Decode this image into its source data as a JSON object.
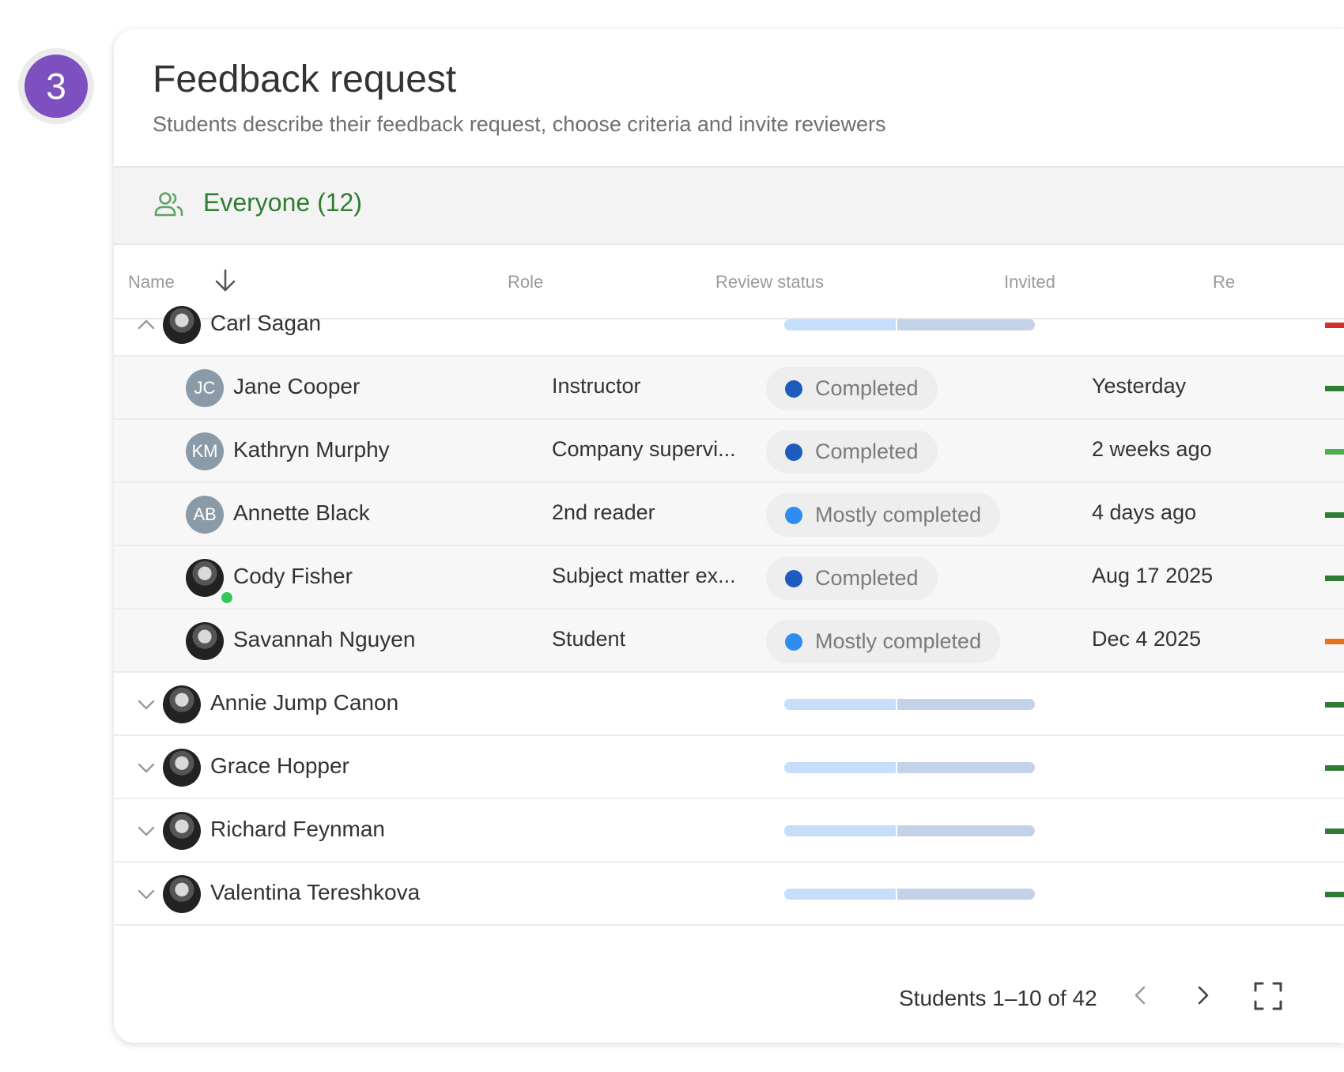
{
  "step": {
    "number": "3"
  },
  "header": {
    "title": "Feedback request",
    "subtitle": "Students describe their feedback request, choose criteria and invite reviewers"
  },
  "group": {
    "icon": "people-icon",
    "label": "Everyone (12)",
    "color": "#2e7d32"
  },
  "columns": {
    "name": "Name",
    "role": "Role",
    "review_status": "Review status",
    "invited": "Invited",
    "partial": "Re"
  },
  "rows": [
    {
      "type": "student",
      "expanded": true,
      "name": "Carl Sagan",
      "progress": 0.45,
      "marker": "#d32f2f"
    },
    {
      "type": "reviewer",
      "name": "Jane Cooper",
      "initials": "JC",
      "role": "Instructor",
      "status": "Completed",
      "status_color": "#1e5bbf",
      "invited": "Yesterday",
      "marker": "#2e7d32"
    },
    {
      "type": "reviewer",
      "name": "Kathryn Murphy",
      "initials": "KM",
      "role": "Company supervi...",
      "status": "Completed",
      "status_color": "#1e5bbf",
      "invited": "2 weeks ago",
      "marker": "#4caf50"
    },
    {
      "type": "reviewer",
      "name": "Annette Black",
      "initials": "AB",
      "role": "2nd reader",
      "status": "Mostly completed",
      "status_color": "#2d8cf0",
      "invited": "4 days ago",
      "marker": "#2e7d32"
    },
    {
      "type": "reviewer",
      "name": "Cody Fisher",
      "initials": "",
      "online": true,
      "role": "Subject matter ex...",
      "status": "Completed",
      "status_color": "#1e5bbf",
      "invited": "Aug 17 2025",
      "marker": "#2e7d32"
    },
    {
      "type": "reviewer",
      "name": "Savannah Nguyen",
      "initials": "",
      "role": "Student",
      "status": "Mostly completed",
      "status_color": "#2d8cf0",
      "invited": "Dec 4 2025",
      "marker": "#e8711b"
    },
    {
      "type": "student",
      "expanded": false,
      "name": "Annie Jump Canon",
      "progress": 0.45,
      "marker": "#2e7d32"
    },
    {
      "type": "student",
      "expanded": false,
      "name": "Grace Hopper",
      "progress": 0.45,
      "marker": "#2e7d32"
    },
    {
      "type": "student",
      "expanded": false,
      "name": "Richard Feynman",
      "progress": 0.45,
      "marker": "#2e7d32"
    },
    {
      "type": "student",
      "expanded": false,
      "name": "Valentina Tereshkova",
      "progress": 0.45,
      "marker": "#2e7d32"
    }
  ],
  "footer": {
    "pagination": "Students 1–10 of 42",
    "prev_icon": "chevron-left-icon",
    "next_icon": "chevron-right-icon",
    "fullscreen_icon": "fullscreen-icon"
  }
}
